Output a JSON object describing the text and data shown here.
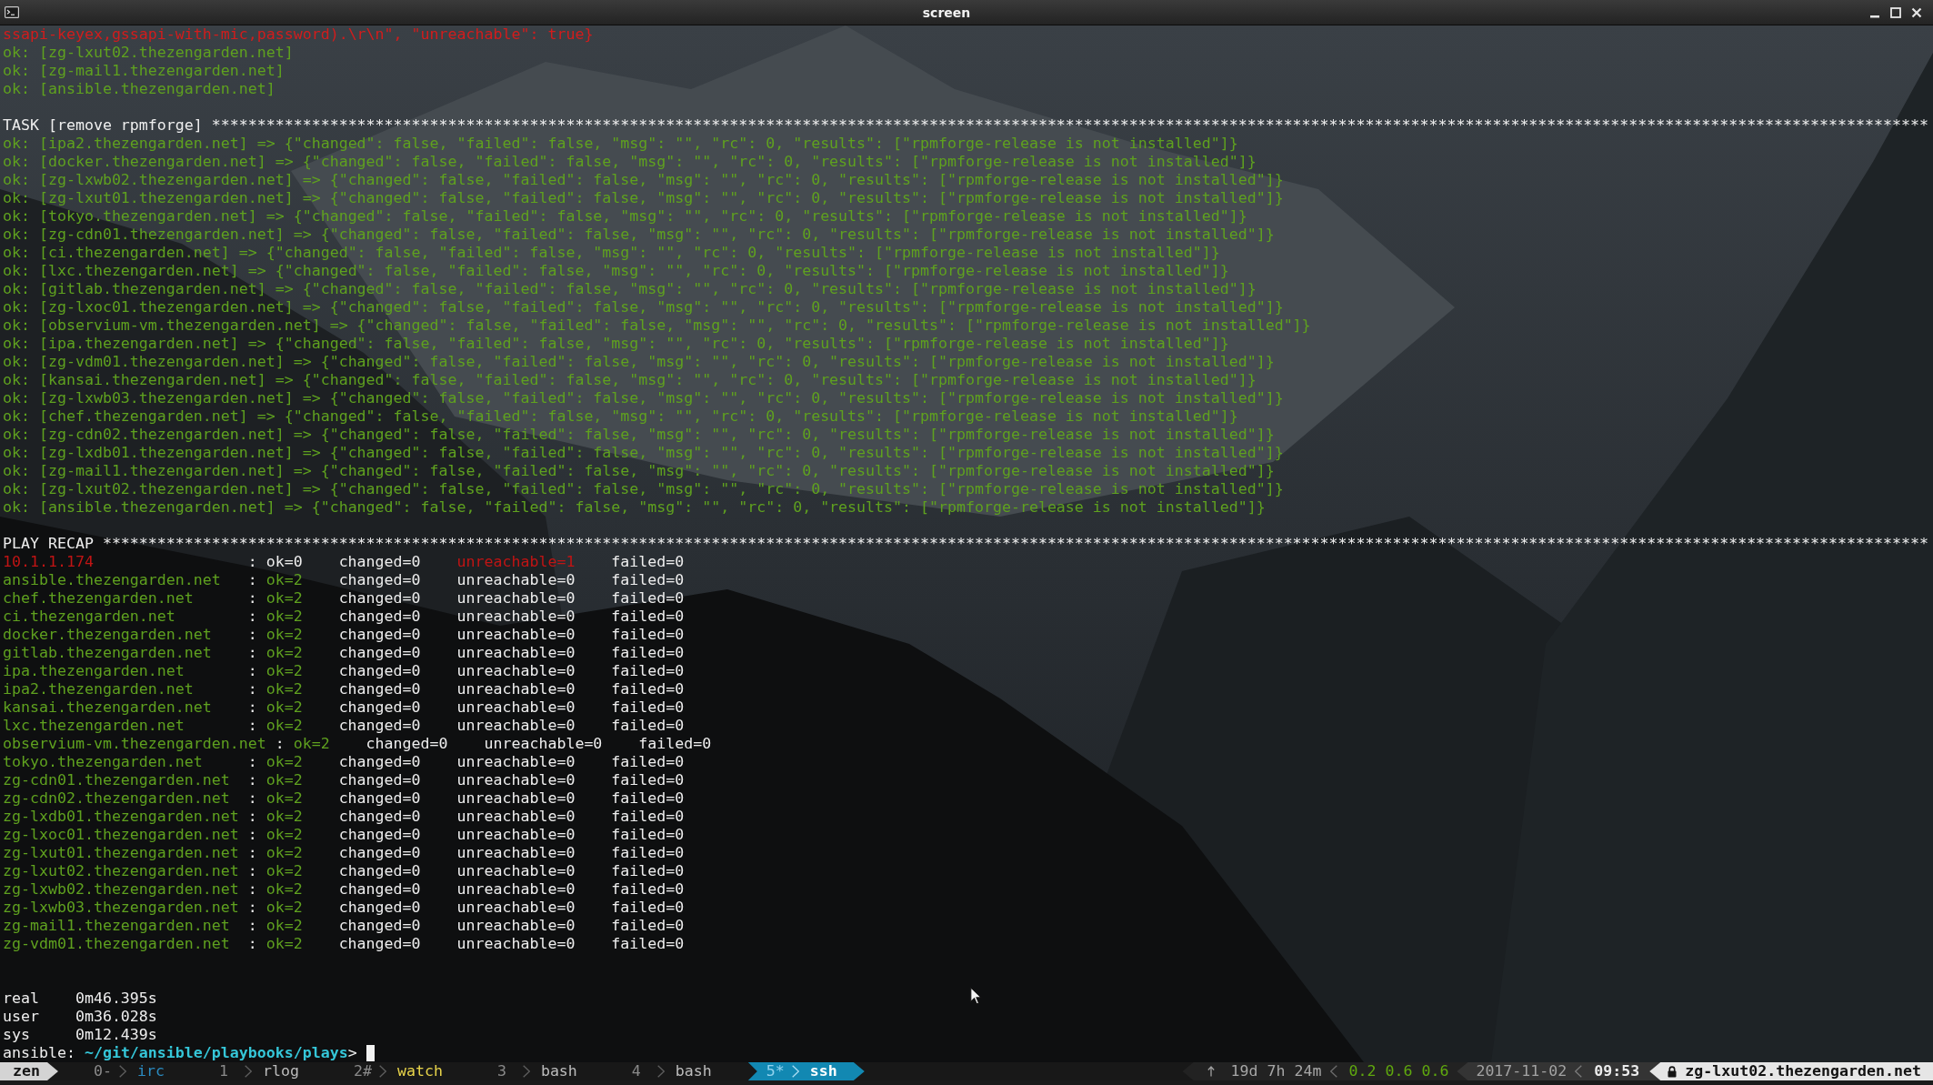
{
  "window": {
    "title": "screen"
  },
  "terminal": {
    "log_tail": [
      {
        "kind": "error",
        "text": "ssapi-keyex,gssapi-with-mic,password).\\r\\n\", \"unreachable\": true}"
      },
      {
        "kind": "ok",
        "text": "ok: [zg-lxut02.thezengarden.net]"
      },
      {
        "kind": "ok",
        "text": "ok: [zg-mail1.thezengarden.net]"
      },
      {
        "kind": "ok",
        "text": "ok: [ansible.thezengarden.net]"
      }
    ],
    "task": {
      "banner": "TASK [remove rpmforge] *********************************************************************************************************************************************************************************************",
      "results": [
        "ok: [ipa2.thezengarden.net] => {\"changed\": false, \"failed\": false, \"msg\": \"\", \"rc\": 0, \"results\": [\"rpmforge-release is not installed\"]}",
        "ok: [docker.thezengarden.net] => {\"changed\": false, \"failed\": false, \"msg\": \"\", \"rc\": 0, \"results\": [\"rpmforge-release is not installed\"]}",
        "ok: [zg-lxwb02.thezengarden.net] => {\"changed\": false, \"failed\": false, \"msg\": \"\", \"rc\": 0, \"results\": [\"rpmforge-release is not installed\"]}",
        "ok: [zg-lxut01.thezengarden.net] => {\"changed\": false, \"failed\": false, \"msg\": \"\", \"rc\": 0, \"results\": [\"rpmforge-release is not installed\"]}",
        "ok: [tokyo.thezengarden.net] => {\"changed\": false, \"failed\": false, \"msg\": \"\", \"rc\": 0, \"results\": [\"rpmforge-release is not installed\"]}",
        "ok: [zg-cdn01.thezengarden.net] => {\"changed\": false, \"failed\": false, \"msg\": \"\", \"rc\": 0, \"results\": [\"rpmforge-release is not installed\"]}",
        "ok: [ci.thezengarden.net] => {\"changed\": false, \"failed\": false, \"msg\": \"\", \"rc\": 0, \"results\": [\"rpmforge-release is not installed\"]}",
        "ok: [lxc.thezengarden.net] => {\"changed\": false, \"failed\": false, \"msg\": \"\", \"rc\": 0, \"results\": [\"rpmforge-release is not installed\"]}",
        "ok: [gitlab.thezengarden.net] => {\"changed\": false, \"failed\": false, \"msg\": \"\", \"rc\": 0, \"results\": [\"rpmforge-release is not installed\"]}",
        "ok: [zg-lxoc01.thezengarden.net] => {\"changed\": false, \"failed\": false, \"msg\": \"\", \"rc\": 0, \"results\": [\"rpmforge-release is not installed\"]}",
        "ok: [observium-vm.thezengarden.net] => {\"changed\": false, \"failed\": false, \"msg\": \"\", \"rc\": 0, \"results\": [\"rpmforge-release is not installed\"]}",
        "ok: [ipa.thezengarden.net] => {\"changed\": false, \"failed\": false, \"msg\": \"\", \"rc\": 0, \"results\": [\"rpmforge-release is not installed\"]}",
        "ok: [zg-vdm01.thezengarden.net] => {\"changed\": false, \"failed\": false, \"msg\": \"\", \"rc\": 0, \"results\": [\"rpmforge-release is not installed\"]}",
        "ok: [kansai.thezengarden.net] => {\"changed\": false, \"failed\": false, \"msg\": \"\", \"rc\": 0, \"results\": [\"rpmforge-release is not installed\"]}",
        "ok: [zg-lxwb03.thezengarden.net] => {\"changed\": false, \"failed\": false, \"msg\": \"\", \"rc\": 0, \"results\": [\"rpmforge-release is not installed\"]}",
        "ok: [chef.thezengarden.net] => {\"changed\": false, \"failed\": false, \"msg\": \"\", \"rc\": 0, \"results\": [\"rpmforge-release is not installed\"]}",
        "ok: [zg-cdn02.thezengarden.net] => {\"changed\": false, \"failed\": false, \"msg\": \"\", \"rc\": 0, \"results\": [\"rpmforge-release is not installed\"]}",
        "ok: [zg-lxdb01.thezengarden.net] => {\"changed\": false, \"failed\": false, \"msg\": \"\", \"rc\": 0, \"results\": [\"rpmforge-release is not installed\"]}",
        "ok: [zg-mail1.thezengarden.net] => {\"changed\": false, \"failed\": false, \"msg\": \"\", \"rc\": 0, \"results\": [\"rpmforge-release is not installed\"]}",
        "ok: [zg-lxut02.thezengarden.net] => {\"changed\": false, \"failed\": false, \"msg\": \"\", \"rc\": 0, \"results\": [\"rpmforge-release is not installed\"]}",
        "ok: [ansible.thezengarden.net] => {\"changed\": false, \"failed\": false, \"msg\": \"\", \"rc\": 0, \"results\": [\"rpmforge-release is not installed\"]}"
      ]
    },
    "recap": {
      "banner": "PLAY RECAP *********************************************************************************************************************************************************************************************************",
      "rows": [
        {
          "host": "10.1.1.174",
          "reached": false,
          "separator": ":",
          "ok": "ok=0",
          "changed": "changed=0",
          "unreachable": "unreachable=1",
          "failed": "failed=0"
        },
        {
          "host": "ansible.thezengarden.net",
          "reached": true,
          "separator": ":",
          "ok": "ok=2",
          "changed": "changed=0",
          "unreachable": "unreachable=0",
          "failed": "failed=0"
        },
        {
          "host": "chef.thezengarden.net",
          "reached": true,
          "separator": ":",
          "ok": "ok=2",
          "changed": "changed=0",
          "unreachable": "unreachable=0",
          "failed": "failed=0"
        },
        {
          "host": "ci.thezengarden.net",
          "reached": true,
          "separator": ":",
          "ok": "ok=2",
          "changed": "changed=0",
          "unreachable": "unreachable=0",
          "failed": "failed=0"
        },
        {
          "host": "docker.thezengarden.net",
          "reached": true,
          "separator": ":",
          "ok": "ok=2",
          "changed": "changed=0",
          "unreachable": "unreachable=0",
          "failed": "failed=0"
        },
        {
          "host": "gitlab.thezengarden.net",
          "reached": true,
          "separator": ":",
          "ok": "ok=2",
          "changed": "changed=0",
          "unreachable": "unreachable=0",
          "failed": "failed=0"
        },
        {
          "host": "ipa.thezengarden.net",
          "reached": true,
          "separator": ":",
          "ok": "ok=2",
          "changed": "changed=0",
          "unreachable": "unreachable=0",
          "failed": "failed=0"
        },
        {
          "host": "ipa2.thezengarden.net",
          "reached": true,
          "separator": ":",
          "ok": "ok=2",
          "changed": "changed=0",
          "unreachable": "unreachable=0",
          "failed": "failed=0"
        },
        {
          "host": "kansai.thezengarden.net",
          "reached": true,
          "separator": ":",
          "ok": "ok=2",
          "changed": "changed=0",
          "unreachable": "unreachable=0",
          "failed": "failed=0"
        },
        {
          "host": "lxc.thezengarden.net",
          "reached": true,
          "separator": ":",
          "ok": "ok=2",
          "changed": "changed=0",
          "unreachable": "unreachable=0",
          "failed": "failed=0"
        },
        {
          "host": "observium-vm.thezengarden.net",
          "reached": true,
          "separator": ":",
          "ok": "ok=2",
          "changed": "changed=0",
          "unreachable": "unreachable=0",
          "failed": "failed=0"
        },
        {
          "host": "tokyo.thezengarden.net",
          "reached": true,
          "separator": ":",
          "ok": "ok=2",
          "changed": "changed=0",
          "unreachable": "unreachable=0",
          "failed": "failed=0"
        },
        {
          "host": "zg-cdn01.thezengarden.net",
          "reached": true,
          "separator": ":",
          "ok": "ok=2",
          "changed": "changed=0",
          "unreachable": "unreachable=0",
          "failed": "failed=0"
        },
        {
          "host": "zg-cdn02.thezengarden.net",
          "reached": true,
          "separator": ":",
          "ok": "ok=2",
          "changed": "changed=0",
          "unreachable": "unreachable=0",
          "failed": "failed=0"
        },
        {
          "host": "zg-lxdb01.thezengarden.net",
          "reached": true,
          "separator": ":",
          "ok": "ok=2",
          "changed": "changed=0",
          "unreachable": "unreachable=0",
          "failed": "failed=0"
        },
        {
          "host": "zg-lxoc01.thezengarden.net",
          "reached": true,
          "separator": ":",
          "ok": "ok=2",
          "changed": "changed=0",
          "unreachable": "unreachable=0",
          "failed": "failed=0"
        },
        {
          "host": "zg-lxut01.thezengarden.net",
          "reached": true,
          "separator": ":",
          "ok": "ok=2",
          "changed": "changed=0",
          "unreachable": "unreachable=0",
          "failed": "failed=0"
        },
        {
          "host": "zg-lxut02.thezengarden.net",
          "reached": true,
          "separator": ":",
          "ok": "ok=2",
          "changed": "changed=0",
          "unreachable": "unreachable=0",
          "failed": "failed=0"
        },
        {
          "host": "zg-lxwb02.thezengarden.net",
          "reached": true,
          "separator": ":",
          "ok": "ok=2",
          "changed": "changed=0",
          "unreachable": "unreachable=0",
          "failed": "failed=0"
        },
        {
          "host": "zg-lxwb03.thezengarden.net",
          "reached": true,
          "separator": ":",
          "ok": "ok=2",
          "changed": "changed=0",
          "unreachable": "unreachable=0",
          "failed": "failed=0"
        },
        {
          "host": "zg-mail1.thezengarden.net",
          "reached": true,
          "separator": ":",
          "ok": "ok=2",
          "changed": "changed=0",
          "unreachable": "unreachable=0",
          "failed": "failed=0"
        },
        {
          "host": "zg-vdm01.thezengarden.net",
          "reached": true,
          "separator": ":",
          "ok": "ok=2",
          "changed": "changed=0",
          "unreachable": "unreachable=0",
          "failed": "failed=0"
        }
      ]
    },
    "timing": [
      {
        "label": "real",
        "value": "0m46.395s"
      },
      {
        "label": "user",
        "value": "0m36.028s"
      },
      {
        "label": "sys",
        "value": "0m12.439s"
      }
    ],
    "prompt": {
      "host": "ansible:",
      "path": "~/git/ansible/playbooks/plays",
      "symbol": ">"
    }
  },
  "status_bar": {
    "session": "zen",
    "windows": [
      {
        "index": "0-",
        "name": "irc",
        "color": "#2b8cc2",
        "selected": false
      },
      {
        "index": "1",
        "name": "rlog",
        "color": "#bcbcbc",
        "selected": false
      },
      {
        "index": "2#",
        "name": "watch",
        "color": "#e8d44a",
        "selected": false
      },
      {
        "index": "3",
        "name": "bash",
        "color": "#bcbcbc",
        "selected": false
      },
      {
        "index": "4",
        "name": "bash",
        "color": "#bcbcbc",
        "selected": false
      },
      {
        "index": "5*",
        "name": "ssh",
        "selected": true
      }
    ],
    "uptime": "19d 7h 24m",
    "load": "0.2 0.6 0.6",
    "date": "2017-11-02",
    "time": "09:53",
    "host": "zg-lxut02.thezengarden.net"
  }
}
